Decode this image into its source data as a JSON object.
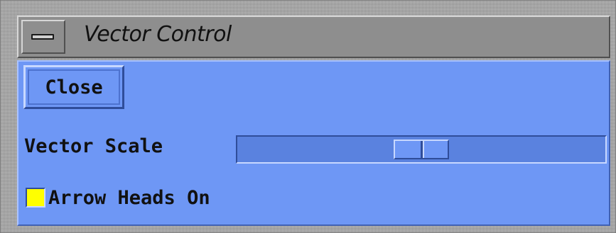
{
  "window": {
    "title": "Vector Control",
    "menu_icon": "window-menu-icon"
  },
  "controls": {
    "close_label": "Close",
    "vector_scale": {
      "label": "Vector Scale",
      "value": 0.5
    },
    "arrow_heads": {
      "label": "Arrow Heads On",
      "checked": true,
      "indicator_color": "#ffff00"
    }
  },
  "colors": {
    "background": "#6e97f5",
    "titlebar": "#8e8e8e"
  }
}
